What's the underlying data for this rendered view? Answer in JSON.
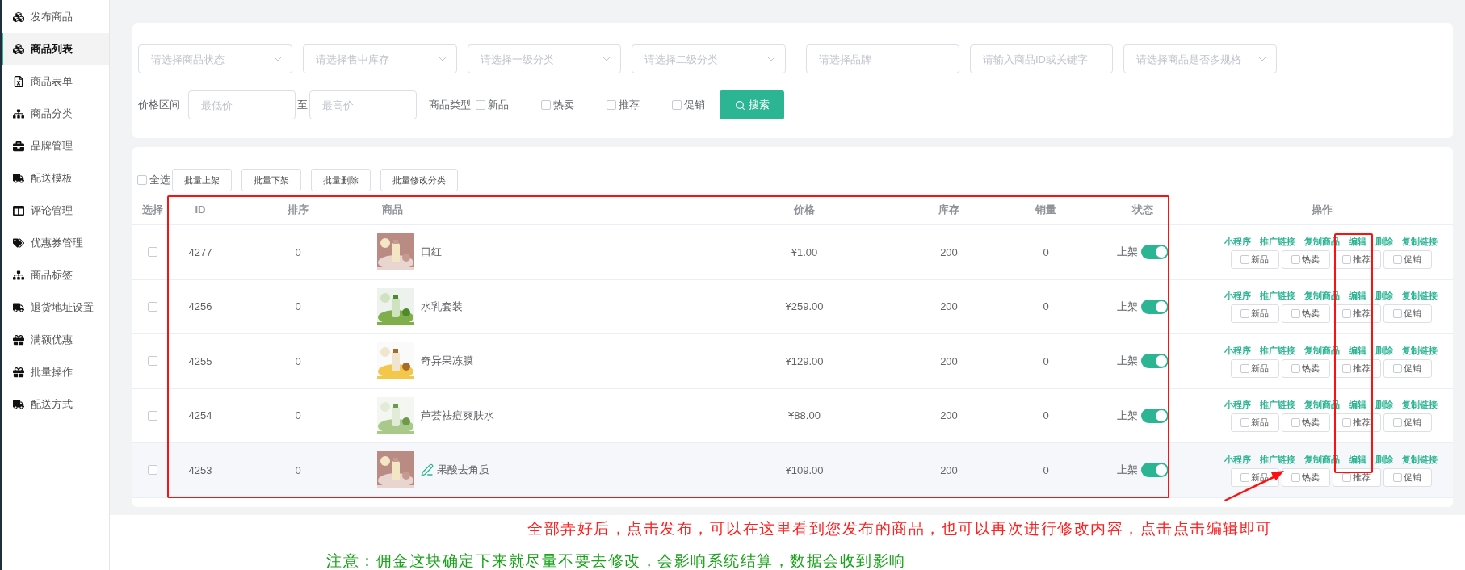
{
  "sidebar": {
    "items": [
      {
        "label": "发布商品",
        "selected": false
      },
      {
        "label": "商品列表",
        "selected": true
      },
      {
        "label": "商品表单",
        "selected": false
      },
      {
        "label": "商品分类",
        "selected": false
      },
      {
        "label": "品牌管理",
        "selected": false
      },
      {
        "label": "配送模板",
        "selected": false
      },
      {
        "label": "评论管理",
        "selected": false
      },
      {
        "label": "优惠券管理",
        "selected": false
      },
      {
        "label": "商品标签",
        "selected": false
      },
      {
        "label": "退货地址设置",
        "selected": false
      },
      {
        "label": "满额优惠",
        "selected": false
      },
      {
        "label": "批量操作",
        "selected": false
      },
      {
        "label": "配送方式",
        "selected": false
      }
    ]
  },
  "filters": {
    "fields": [
      {
        "kind": "select",
        "placeholder": "请选择商品状态"
      },
      {
        "kind": "select",
        "placeholder": "请选择售中库存"
      },
      {
        "kind": "select",
        "placeholder": "请选择一级分类"
      },
      {
        "kind": "select",
        "placeholder": "请选择二级分类"
      },
      {
        "kind": "input",
        "placeholder": "请选择品牌"
      },
      {
        "kind": "input",
        "placeholder": "请输入商品ID或关键字"
      },
      {
        "kind": "select",
        "placeholder": "请选择商品是否多规格"
      }
    ],
    "price": {
      "label": "价格区间",
      "min": {
        "placeholder": "最低价"
      },
      "separator": "至",
      "max": {
        "placeholder": "最高价"
      }
    },
    "type_label": "商品类型",
    "type_options": [
      {
        "label": "新品",
        "checked": false
      },
      {
        "label": "热卖",
        "checked": false
      },
      {
        "label": "推荐",
        "checked": false
      },
      {
        "label": "促销",
        "checked": false
      }
    ],
    "search_button": "搜索"
  },
  "batch": {
    "select_all": {
      "label": "全选",
      "checked": false
    },
    "buttons": [
      "批量上架",
      "批量下架",
      "批量删除",
      "批量修改分类"
    ]
  },
  "table": {
    "columns": [
      "选择",
      "ID",
      "排序",
      "商品",
      "价格",
      "库存",
      "销量",
      "状态",
      "操作"
    ],
    "rows": [
      {
        "checked": false,
        "id": "4277",
        "sort": "0",
        "image": {
          "kind": "picture"
        },
        "name": "口红",
        "price": "¥1.00",
        "stock": "200",
        "sales": "0",
        "status": "上架",
        "on": true,
        "hovered": false,
        "actions": [
          "小程序",
          "推广链接",
          "复制商品",
          "编辑",
          "删除",
          "复制链接"
        ],
        "tags": [
          {
            "label": "新品",
            "checked": false
          },
          {
            "label": "热卖",
            "checked": false
          },
          {
            "label": "推荐",
            "checked": false
          },
          {
            "label": "促销",
            "checked": false
          }
        ]
      },
      {
        "checked": false,
        "id": "4256",
        "sort": "0",
        "image": {
          "kind": "picture"
        },
        "name": "水乳套装",
        "price": "¥259.00",
        "stock": "200",
        "sales": "0",
        "status": "上架",
        "on": true,
        "hovered": false,
        "actions": [
          "小程序",
          "推广链接",
          "复制商品",
          "编辑",
          "删除",
          "复制链接"
        ],
        "tags": [
          {
            "label": "新品",
            "checked": false
          },
          {
            "label": "热卖",
            "checked": false
          },
          {
            "label": "推荐",
            "checked": false
          },
          {
            "label": "促销",
            "checked": false
          }
        ]
      },
      {
        "checked": false,
        "id": "4255",
        "sort": "0",
        "image": {
          "kind": "picture"
        },
        "name": "奇异果冻膜",
        "price": "¥129.00",
        "stock": "200",
        "sales": "0",
        "status": "上架",
        "on": true,
        "hovered": false,
        "actions": [
          "小程序",
          "推广链接",
          "复制商品",
          "编辑",
          "删除",
          "复制链接"
        ],
        "tags": [
          {
            "label": "新品",
            "checked": false
          },
          {
            "label": "热卖",
            "checked": false
          },
          {
            "label": "推荐",
            "checked": false
          },
          {
            "label": "促销",
            "checked": false
          }
        ]
      },
      {
        "checked": false,
        "id": "4254",
        "sort": "0",
        "image": {
          "kind": "picture"
        },
        "name": "芦荟祛痘爽肤水",
        "price": "¥88.00",
        "stock": "200",
        "sales": "0",
        "status": "上架",
        "on": true,
        "hovered": false,
        "actions": [
          "小程序",
          "推广链接",
          "复制商品",
          "编辑",
          "删除",
          "复制链接"
        ],
        "tags": [
          {
            "label": "新品",
            "checked": false
          },
          {
            "label": "热卖",
            "checked": false
          },
          {
            "label": "推荐",
            "checked": false
          },
          {
            "label": "促销",
            "checked": false
          }
        ]
      },
      {
        "checked": false,
        "id": "4253",
        "sort": "0",
        "image": {
          "kind": "picture"
        },
        "name": "果酸去角质",
        "price": "¥109.00",
        "stock": "200",
        "sales": "0",
        "status": "上架",
        "on": true,
        "hovered": true,
        "actions": [
          "小程序",
          "推广链接",
          "复制商品",
          "编辑",
          "删除",
          "复制链接"
        ],
        "tags": [
          {
            "label": "新品",
            "checked": false
          },
          {
            "label": "热卖",
            "checked": false
          },
          {
            "label": "推荐",
            "checked": false
          },
          {
            "label": "促销",
            "checked": false
          }
        ]
      }
    ]
  },
  "notes": [
    {
      "text": "全部弄好后，点击发布，可以在这里看到您发布的商品，也可以再次进行修改内容，点击点击编辑即可",
      "color": "#ff2020"
    },
    {
      "text": "注意：佣金这块确定下来就尽量不要去修改，会影响系统结算，数据会收到影响",
      "color": "#1aa31a"
    }
  ]
}
